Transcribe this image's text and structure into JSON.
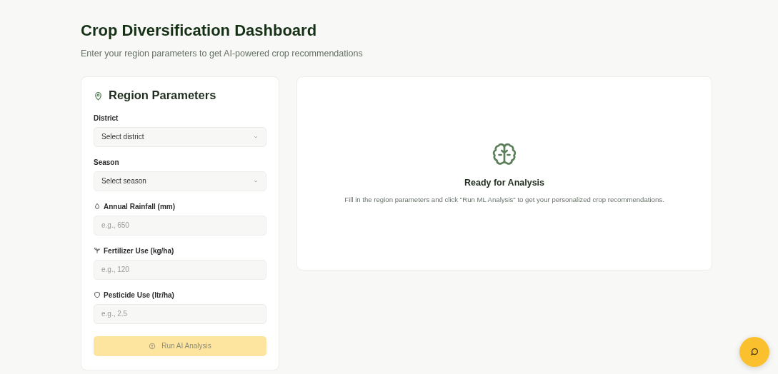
{
  "header": {
    "title": "Crop Diversification Dashboard",
    "subtitle": "Enter your region parameters to get AI-powered crop recommendations"
  },
  "form": {
    "title": "Region Parameters",
    "fields": [
      {
        "kind": "select",
        "label": "District",
        "placeholder": "Select district"
      },
      {
        "kind": "select",
        "label": "Season",
        "placeholder": "Select season"
      },
      {
        "kind": "input",
        "label": "Annual Rainfall (mm)",
        "placeholder": "e.g., 650"
      },
      {
        "kind": "input",
        "label": "Fertilizer Use (kg/ha)",
        "placeholder": "e.g., 120"
      },
      {
        "kind": "input",
        "label": "Pesticide Use (ltr/ha)",
        "placeholder": "e.g., 2.5"
      }
    ],
    "button": {
      "label": "Run AI Analysis",
      "disabled": true
    }
  },
  "result": {
    "title": "Ready for Analysis",
    "message": "Fill in the region parameters and click \"Run ML Analysis\" to get your personalized crop recommendations."
  }
}
